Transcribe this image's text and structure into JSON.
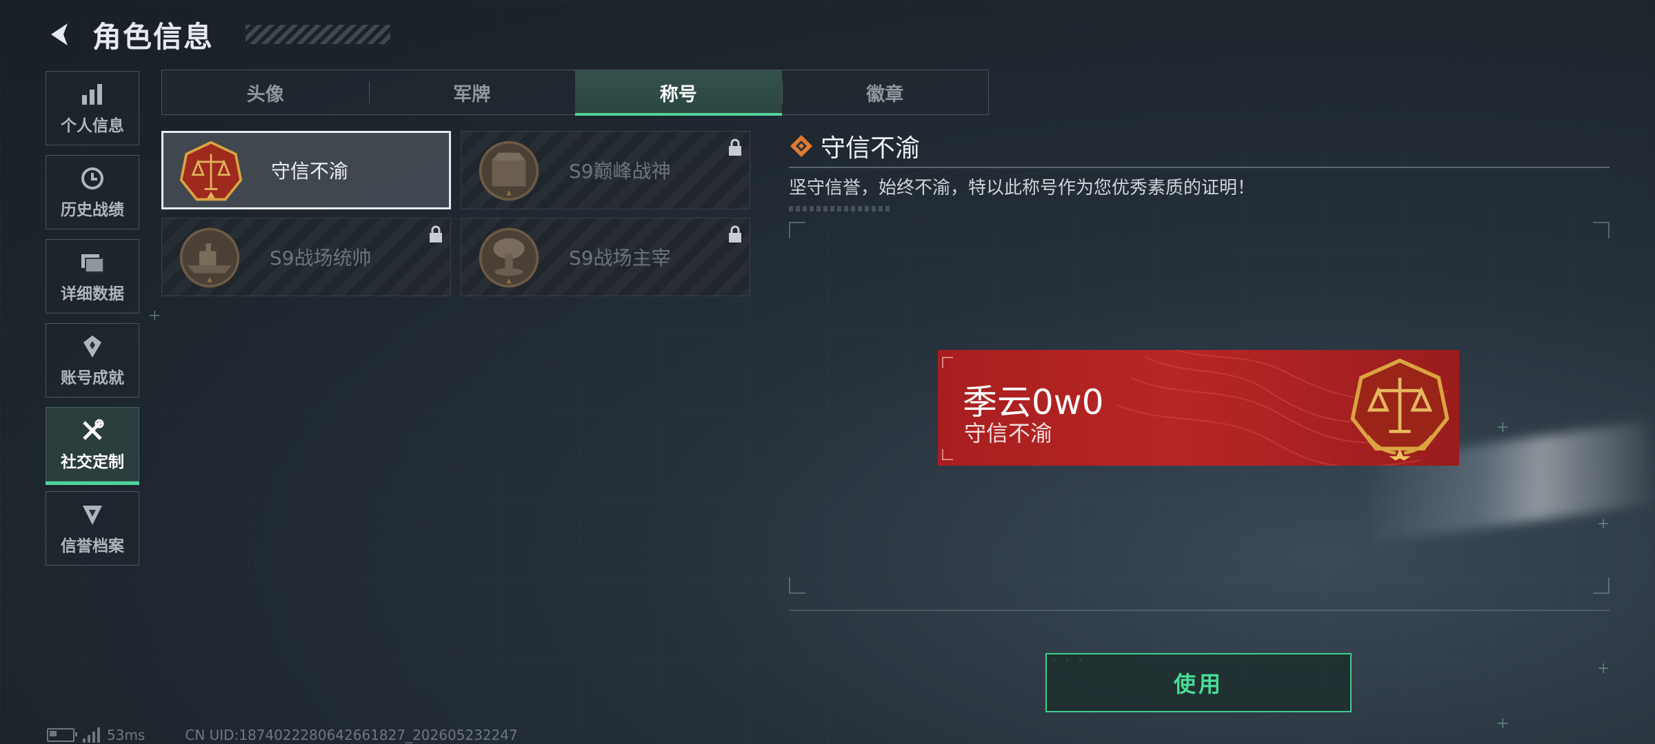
{
  "header": {
    "title": "角色信息"
  },
  "sidebar": {
    "items": [
      {
        "label": "个人信息",
        "icon": "bar-chart-icon",
        "active": false
      },
      {
        "label": "历史战绩",
        "icon": "history-icon",
        "active": false
      },
      {
        "label": "详细数据",
        "icon": "folder-icon",
        "active": false
      },
      {
        "label": "账号成就",
        "icon": "achievement-icon",
        "active": false
      },
      {
        "label": "社交定制",
        "icon": "tools-icon",
        "active": true
      },
      {
        "label": "信誉档案",
        "icon": "credit-shield-icon",
        "active": false
      }
    ]
  },
  "tabs": [
    {
      "label": "头像",
      "active": false
    },
    {
      "label": "军牌",
      "active": false
    },
    {
      "label": "称号",
      "active": true
    },
    {
      "label": "徽章",
      "active": false
    }
  ],
  "titles": [
    {
      "name": "守信不渝",
      "locked": false,
      "selected": true,
      "emblem": "scales-emblem"
    },
    {
      "name": "S9巅峰战神",
      "locked": true,
      "selected": false,
      "emblem": "fortress-emblem"
    },
    {
      "name": "S9战场统帅",
      "locked": true,
      "selected": false,
      "emblem": "warship-emblem"
    },
    {
      "name": "S9战场主宰",
      "locked": true,
      "selected": false,
      "emblem": "mushroom-cloud-emblem"
    }
  ],
  "detail": {
    "title": "守信不渝",
    "description": "坚守信誉，始终不渝，特以此称号作为您优秀素质的证明！"
  },
  "preview": {
    "player_name": "季云0w0",
    "title": "守信不渝"
  },
  "actions": {
    "use_label": "使用"
  },
  "status": {
    "latency": "53ms",
    "uid": "CN UID:1874022280642661827_202605232247"
  },
  "colors": {
    "accent": "#4fd49a",
    "nameplate": "#b02222",
    "emblem_gold": "#d9a441"
  }
}
